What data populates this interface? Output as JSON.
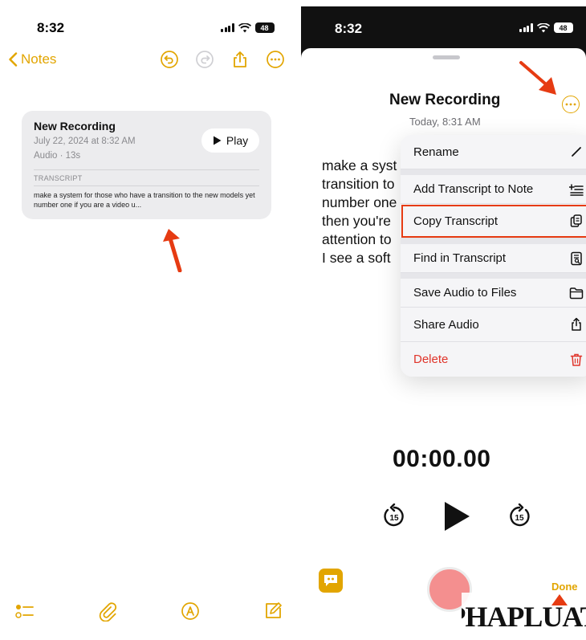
{
  "left": {
    "status_time": "8:32",
    "battery": "48",
    "nav": {
      "back_label": "Notes"
    },
    "card": {
      "title": "New Recording",
      "date": "July 22, 2024 at 8:32 AM",
      "meta": "Audio · 13s",
      "play_label": "Play",
      "section_label": "TRANSCRIPT",
      "transcript_preview": "make a system for those who have a transition to the new models yet number one if you are a video u..."
    }
  },
  "right": {
    "status_time": "8:32",
    "battery": "48",
    "recording_title": "New Recording",
    "recording_date": "Today, 8:31 AM",
    "transcript_lines": [
      "make a syst",
      "transition to",
      "number one",
      "then you're",
      "attention to",
      "I see a soft"
    ],
    "menu": [
      {
        "label": "Rename",
        "icon": "pencil-icon"
      },
      {
        "label": "Add Transcript to Note",
        "icon": "add-text-icon"
      },
      {
        "label": "Copy Transcript",
        "icon": "copy-icon",
        "highlighted": true
      },
      {
        "label": "Find in Transcript",
        "icon": "find-document-icon"
      },
      {
        "label": "Save Audio to Files",
        "icon": "folder-icon"
      },
      {
        "label": "Share Audio",
        "icon": "share-icon"
      },
      {
        "label": "Delete",
        "icon": "trash-icon",
        "destructive": true
      }
    ],
    "timer": "00:00.00",
    "skip_back_label": "15",
    "skip_forward_label": "15",
    "done_label": "Done"
  },
  "watermark": {
    "text": "PHAPLUAT"
  },
  "colors": {
    "accent": "#e2a500",
    "highlight": "#e63b12",
    "destructive": "#e0342a",
    "record": "#f48f8f"
  }
}
